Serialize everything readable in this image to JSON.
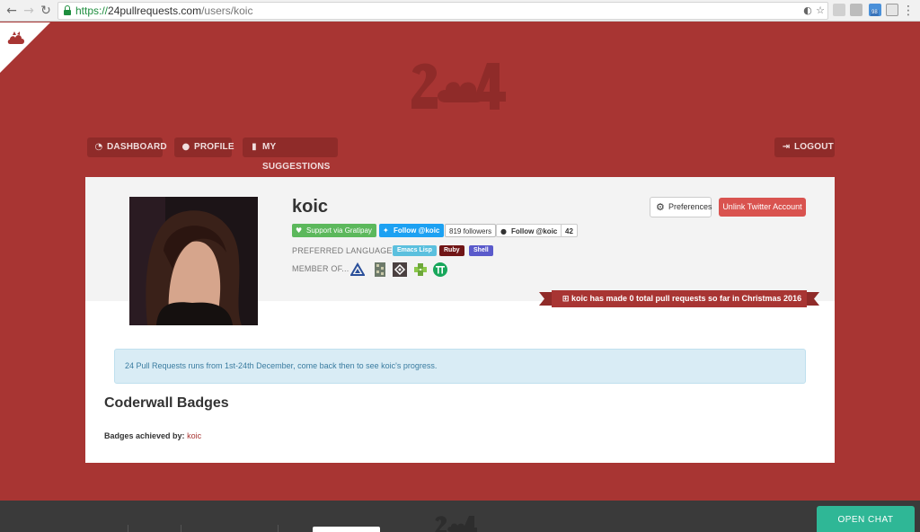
{
  "browser": {
    "url_scheme": "https://",
    "url_host": "24pullrequests.com",
    "url_path": "/users/koic",
    "extension_badge": "98"
  },
  "nav": {
    "dashboard": "DASHBOARD",
    "profile": "PROFILE",
    "suggestions": "MY SUGGESTIONS",
    "logout": "LOGOUT"
  },
  "profile": {
    "username": "koic",
    "gratipay": "Support via Gratipay",
    "twitter_follow": "Follow @koic",
    "twitter_followers": "819 followers",
    "github_follow": "Follow @koic",
    "github_count": "42",
    "preferred_languages_label": "PREFERRED LANGUAGES",
    "languages": [
      {
        "name": "Emacs Lisp",
        "color": "#5bc0de"
      },
      {
        "name": "Ruby",
        "color": "#701516"
      },
      {
        "name": "Shell",
        "color": "#5a5acb"
      }
    ],
    "member_of_label": "MEMBER OF...",
    "preferences_button": "Preferences",
    "unlink_button": "Unlink Twitter Account",
    "banner": "koic has made 0 total pull requests so far in Christmas 2016"
  },
  "notice": "24 Pull Requests runs from 1st-24th December, come back then to see koic's progress.",
  "coderwall": {
    "title": "Coderwall Badges",
    "achieved_label": "Badges achieved by:",
    "achieved_user": "koic"
  },
  "chat": {
    "label": "OPEN CHAT"
  },
  "colors": {
    "page_bg": "#a83533",
    "accent_red": "#d9534f",
    "chat_green": "#2fb796"
  }
}
